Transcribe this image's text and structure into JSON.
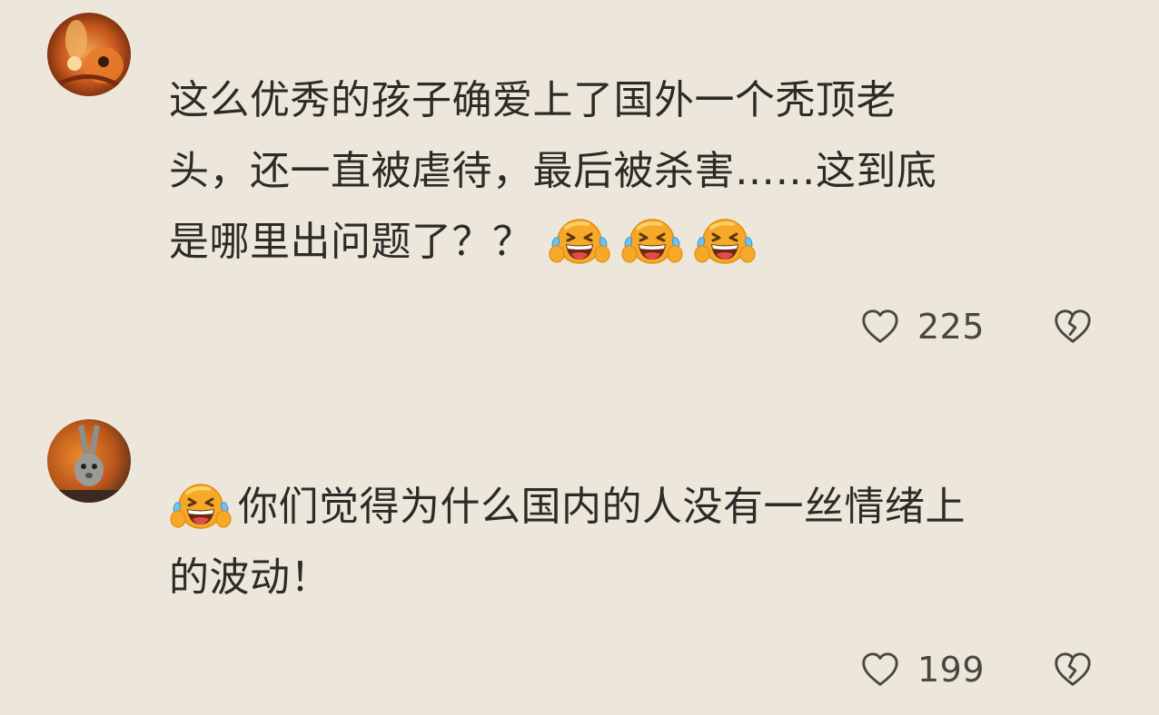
{
  "comments": [
    {
      "text_line_1": "这么优秀的孩子确爱上了国外一个秃顶老",
      "text_line_2": "头，还一直被虐待，最后被杀害……这到底",
      "text_line_3": "是哪里出问题了？？",
      "emoji": "laughing-crying-emoji",
      "likes": "225"
    },
    {
      "text_line_1": "你们觉得为什么国内的人没有一丝情绪上",
      "text_line_2": "的波动！",
      "emoji": "laughing-crying-emoji",
      "likes": "199"
    }
  ],
  "icons": {
    "like": "heart-outline-icon",
    "dislike": "broken-heart-icon"
  },
  "colors": {
    "background": "#ece7da",
    "text": "#2d2b27",
    "icon": "#4a4640",
    "emoji_face": "#f5a623"
  }
}
